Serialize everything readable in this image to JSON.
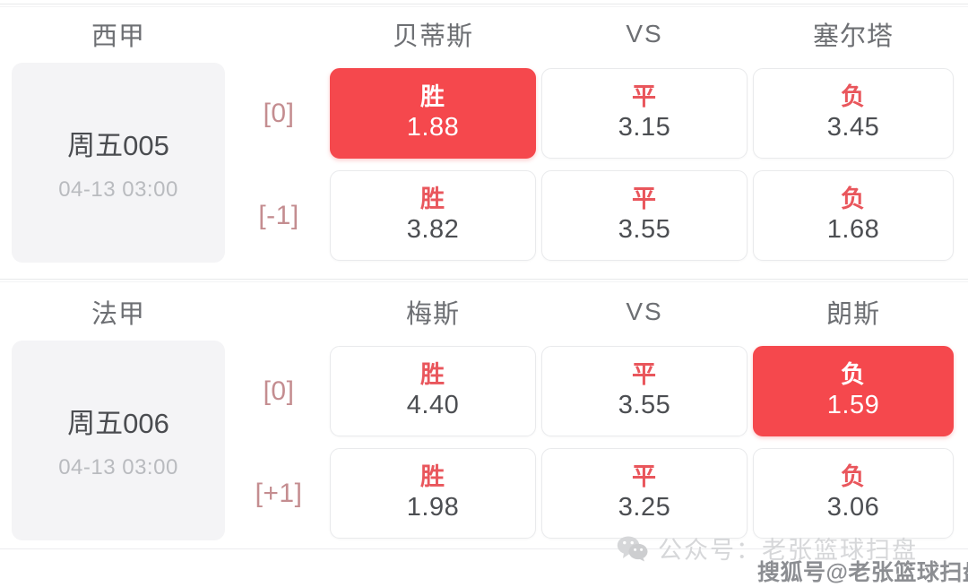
{
  "matches": [
    {
      "league": "西甲",
      "home": "贝蒂斯",
      "vs": "VS",
      "away": "塞尔塔",
      "match_no": "周五005",
      "kickoff": "04-13 03:00",
      "rows": [
        {
          "handicap": "[0]",
          "cells": [
            {
              "result": "胜",
              "odds": "1.88",
              "selected": true
            },
            {
              "result": "平",
              "odds": "3.15",
              "selected": false
            },
            {
              "result": "负",
              "odds": "3.45",
              "selected": false
            }
          ]
        },
        {
          "handicap": "[-1]",
          "cells": [
            {
              "result": "胜",
              "odds": "3.82",
              "selected": false
            },
            {
              "result": "平",
              "odds": "3.55",
              "selected": false
            },
            {
              "result": "负",
              "odds": "1.68",
              "selected": false
            }
          ]
        }
      ]
    },
    {
      "league": "法甲",
      "home": "梅斯",
      "vs": "VS",
      "away": "朗斯",
      "match_no": "周五006",
      "kickoff": "04-13 03:00",
      "rows": [
        {
          "handicap": "[0]",
          "cells": [
            {
              "result": "胜",
              "odds": "4.40",
              "selected": false
            },
            {
              "result": "平",
              "odds": "3.55",
              "selected": false
            },
            {
              "result": "负",
              "odds": "1.59",
              "selected": true
            }
          ]
        },
        {
          "handicap": "[+1]",
          "cells": [
            {
              "result": "胜",
              "odds": "1.98",
              "selected": false
            },
            {
              "result": "平",
              "odds": "3.25",
              "selected": false
            },
            {
              "result": "负",
              "odds": "3.06",
              "selected": false
            }
          ]
        }
      ]
    }
  ],
  "watermarks": {
    "wechat": "公众号：老张篮球扫盘",
    "sohu": "搜狐号@老张篮球扫盘"
  },
  "colors": {
    "selected_bg": "#f5484d",
    "result_red": "#e9565c",
    "handicap": "#c48d90",
    "card_bg": "#f4f4f6",
    "value_text": "#4c4e52",
    "header_text": "#6d6f73",
    "time_text": "#b9bbbf"
  }
}
